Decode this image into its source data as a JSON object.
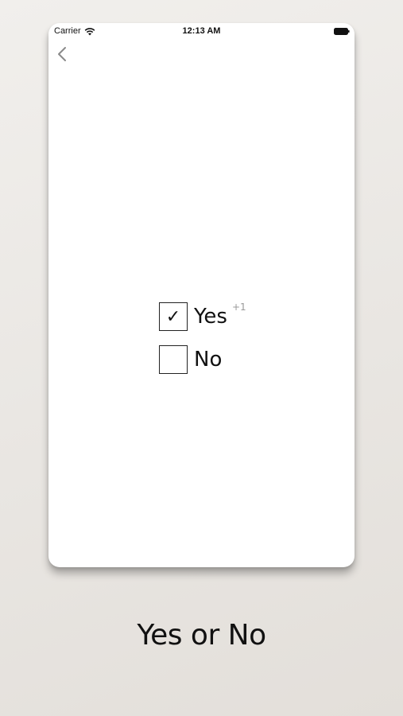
{
  "status_bar": {
    "carrier": "Carrier",
    "time": "12:13 AM",
    "wifi_icon": "wifi-icon",
    "battery_icon": "battery-icon"
  },
  "nav": {
    "back_icon": "chevron-left-icon"
  },
  "poll": {
    "options": [
      {
        "label": "Yes",
        "checked": true,
        "check_mark": "✓",
        "votes": "+1"
      },
      {
        "label": "No",
        "checked": false,
        "check_mark": "",
        "votes": ""
      }
    ]
  },
  "caption": "Yes or No"
}
